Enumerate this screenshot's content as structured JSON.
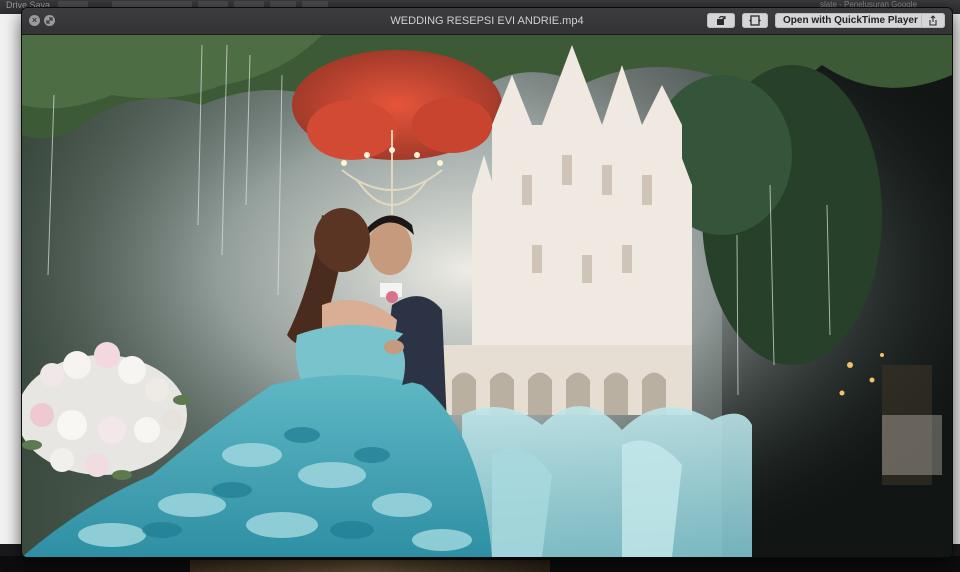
{
  "background": {
    "left_label": "Drive Sava",
    "right_label": "slate - Penelusuran Google"
  },
  "window": {
    "title": "WEDDING RESEPSI EVI ANDRIE.mp4",
    "open_with_label": "Open with QuickTime Player",
    "close_icon": "close-icon",
    "fullscreen_icon": "fullscreen-icon",
    "rotate_icon": "rotate-icon",
    "trim_icon": "trim-icon",
    "share_icon": "share-icon"
  },
  "video": {
    "scene": "wedding-reception-video-frame"
  }
}
